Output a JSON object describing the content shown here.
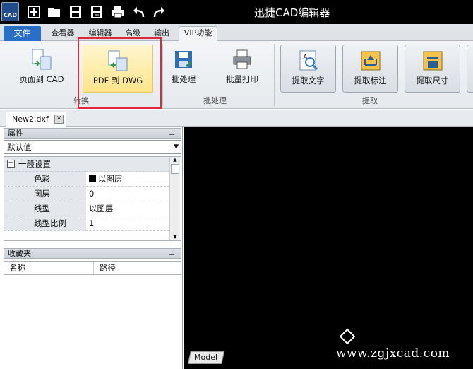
{
  "app": {
    "logo_text": "CAD",
    "title": "迅捷CAD编辑器"
  },
  "quick_access": [
    "new-icon",
    "open-icon",
    "save-icon",
    "save-as-icon",
    "print-icon",
    "undo-icon",
    "redo-icon"
  ],
  "tabs": {
    "file": "文件",
    "viewer": "查看器",
    "editor": "编辑器",
    "advanced": "高级",
    "output": "输出",
    "vip": "VIP功能",
    "active": "VIP功能"
  },
  "ribbon": {
    "groups": {
      "convert": "转换",
      "batch": "批处理",
      "extract": "提取"
    },
    "buttons": {
      "page_to_cad": "页面到 CAD",
      "pdf_to_dwg": "PDF 到 DWG",
      "batch_process": "批处理",
      "batch_print": "批量打印",
      "extract_text": "提取文字",
      "extract_annotation": "提取标注",
      "extract_dimension": "提取尺寸"
    }
  },
  "document_tab": {
    "name": "New2.dxf"
  },
  "properties_panel": {
    "title": "属性",
    "selector_value": "默认值",
    "section": "一般设置",
    "rows": [
      {
        "key": "色彩",
        "value": "以图层"
      },
      {
        "key": "图层",
        "value": "0"
      },
      {
        "key": "线型",
        "value": "以图层"
      },
      {
        "key": "线型比例",
        "value": "1"
      }
    ]
  },
  "favorites_panel": {
    "title": "收藏夹",
    "columns": [
      "名称",
      "路径"
    ]
  },
  "canvas": {
    "layout_tab": "Model",
    "watermark": "www.zgjxcad.com"
  },
  "colors": {
    "accent": "#2a6fc5",
    "highlight_border": "#e0283a",
    "canvas_bg": "#000000"
  }
}
